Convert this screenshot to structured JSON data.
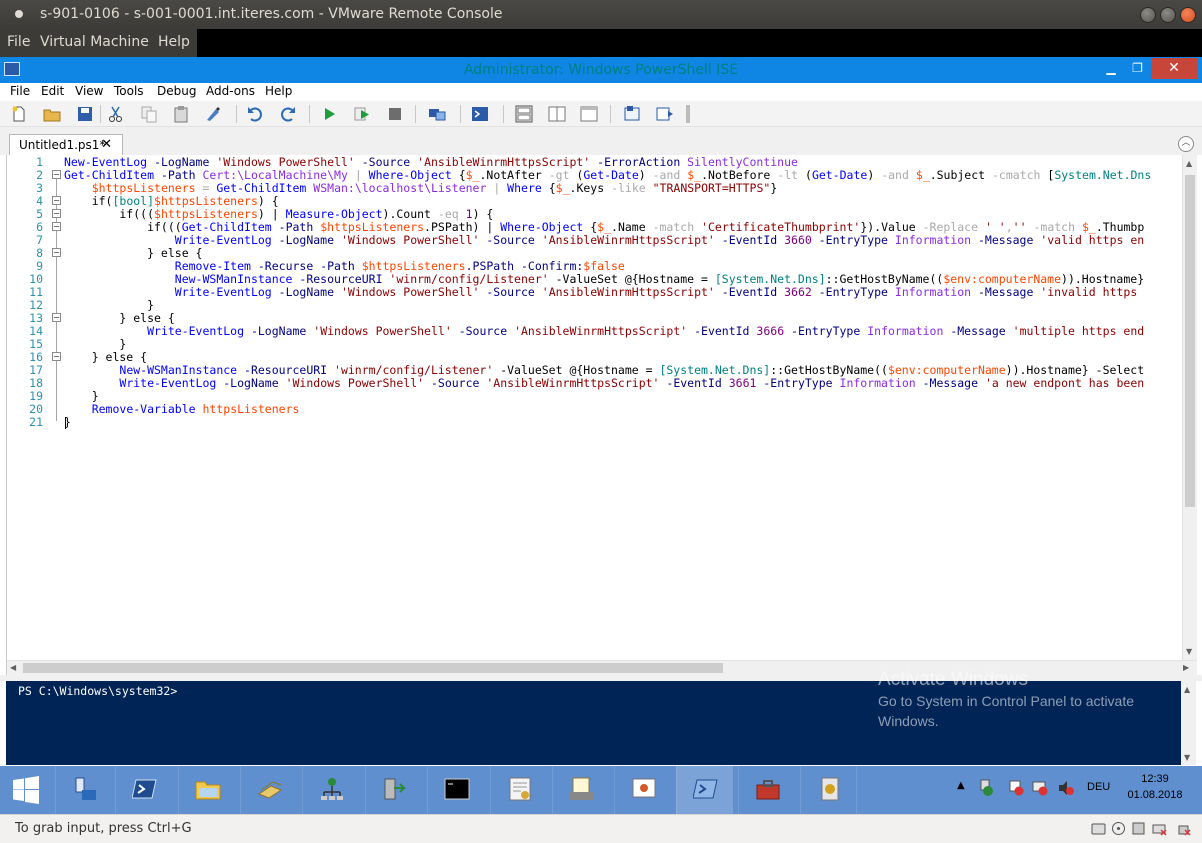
{
  "vm_window": {
    "title": "s-901-0106 - s-001-0001.int.iteres.com - VMware Remote Console",
    "menu": [
      "File",
      "Virtual Machine",
      "Help"
    ],
    "status_message": "To grab input, press Ctrl+G"
  },
  "ise": {
    "title": "Administrator: Windows PowerShell ISE",
    "menu": [
      "File",
      "Edit",
      "View",
      "Tools",
      "Debug",
      "Add-ons",
      "Help"
    ],
    "tab_label": "Untitled1.ps1*",
    "tab_close": "✕",
    "line_numbers": [
      "1",
      "2",
      "3",
      "4",
      "5",
      "6",
      "7",
      "8",
      "9",
      "10",
      "11",
      "12",
      "13",
      "14",
      "15",
      "16",
      "17",
      "18",
      "19",
      "20",
      "21"
    ],
    "console_prompt": "PS C:\\Windows\\system32>"
  },
  "code": {
    "line1": [
      "New-EventLog",
      " -LogName ",
      "'Windows PowerShell'",
      " -Source ",
      "'AnsibleWinrmHttpsScript'",
      " -ErrorAction ",
      "SilentlyContinue"
    ],
    "line2": [
      "Get-ChildItem",
      " -Path ",
      "Cert:\\LocalMachine\\My",
      " | ",
      "Where-Object",
      " {",
      "$_",
      ".NotAfter ",
      "-gt",
      " (",
      "Get-Date",
      ") ",
      "-and",
      " ",
      "$_",
      ".NotBefore ",
      "-lt",
      " (",
      "Get-Date",
      ") ",
      "-and",
      " ",
      "$_",
      ".Subject ",
      "-cmatch",
      " [",
      "System.Net.Dns"
    ],
    "line3": [
      "    ",
      "$httpsListeners",
      " = ",
      "Get-ChildItem",
      " ",
      "WSMan:\\localhost\\Listener",
      " | ",
      "Where",
      " {",
      "$_",
      ".Keys ",
      "-like",
      " ",
      "\"TRANSPORT=HTTPS\"",
      "}"
    ],
    "line4": [
      "    if(",
      "[bool]",
      "$httpsListeners",
      ") {"
    ],
    "line5": [
      "        if(((",
      "$httpsListeners",
      ") | ",
      "Measure-Object",
      ").Count ",
      "-eq",
      " ",
      "1",
      ") {"
    ],
    "line6": [
      "            if(((",
      "Get-ChildItem",
      " -Path ",
      "$httpsListeners",
      ".PSPath) | ",
      "Where-Object",
      " {",
      "$_",
      ".Name ",
      "-match",
      " ",
      "'CertificateThumbprint'",
      "}).Value ",
      "-Replace",
      " ",
      "' '",
      ",",
      "''",
      " ",
      "-match",
      " ",
      "$_",
      ".Thumbp"
    ],
    "line7": [
      "                ",
      "Write-EventLog",
      " -LogName ",
      "'Windows PowerShell'",
      " -Source ",
      "'AnsibleWinrmHttpsScript'",
      " -EventId ",
      "3660",
      " -EntryType ",
      "Information",
      " -Message ",
      "'valid https en"
    ],
    "line8": [
      "            } else {"
    ],
    "line9": [
      "                ",
      "Remove-Item",
      " -Recurse -Path ",
      "$httpsListeners",
      ".PSPath -Confirm:",
      "$false"
    ],
    "line10": [
      "                ",
      "New-WSManInstance",
      " -ResourceURI ",
      "'winrm/config/Listener'",
      " -ValueSet @{Hostname = ",
      "[System.Net.Dns]",
      "::GetHostByName((",
      "$env:computerName",
      ")).Hostname}"
    ],
    "line11": [
      "                ",
      "Write-EventLog",
      " -LogName ",
      "'Windows PowerShell'",
      " -Source ",
      "'AnsibleWinrmHttpsScript'",
      " -EventId ",
      "3662",
      " -EntryType ",
      "Information",
      " -Message ",
      "'invalid https"
    ],
    "line12": [
      "            }"
    ],
    "line13": [
      "        } else {"
    ],
    "line14": [
      "            ",
      "Write-EventLog",
      " -LogName ",
      "'Windows PowerShell'",
      " -Source ",
      "'AnsibleWinrmHttpsScript'",
      " -EventId ",
      "3666",
      " -EntryType ",
      "Information",
      " -Message ",
      "'multiple https end"
    ],
    "line15": [
      "        }"
    ],
    "line16": [
      "    } else {"
    ],
    "line17": [
      "        ",
      "New-WSManInstance",
      " -ResourceURI ",
      "'winrm/config/Listener'",
      " -ValueSet @{Hostname = ",
      "[System.Net.Dns]",
      "::GetHostByName((",
      "$env:computerName",
      ")).Hostname} -Select"
    ],
    "line18": [
      "        ",
      "Write-EventLog",
      " -LogName ",
      "'Windows PowerShell'",
      " -Source ",
      "'AnsibleWinrmHttpsScript'",
      " -EventId ",
      "3661",
      " -EntryType ",
      "Information",
      " -Message ",
      "'a new endpont has been"
    ],
    "line19": [
      "    }"
    ],
    "line20": [
      "    ",
      "Remove-Variable",
      " ",
      "httpsListeners"
    ],
    "line21": [
      "}"
    ]
  },
  "watermark": {
    "heading": "Activate Windows",
    "line1": "Go to System in Control Panel to activate",
    "line2": "Windows."
  },
  "taskbar": {
    "language": "DEU",
    "time": "12:39",
    "date": "01.08.2018",
    "apps": [
      "server-manager-icon",
      "powershell-icon",
      "file-explorer-icon",
      "tools-icon",
      "network-icon",
      "migration-icon",
      "cmd-icon",
      "certificate-icon",
      "certificate-tool-icon",
      "presentation-icon",
      "powershell-ise-icon",
      "toolbox-icon",
      "security-icon"
    ]
  },
  "colors": {
    "ise_title_bar": "#0f86e3",
    "console_background": "#012456",
    "taskbar": "#5f8fcf"
  }
}
